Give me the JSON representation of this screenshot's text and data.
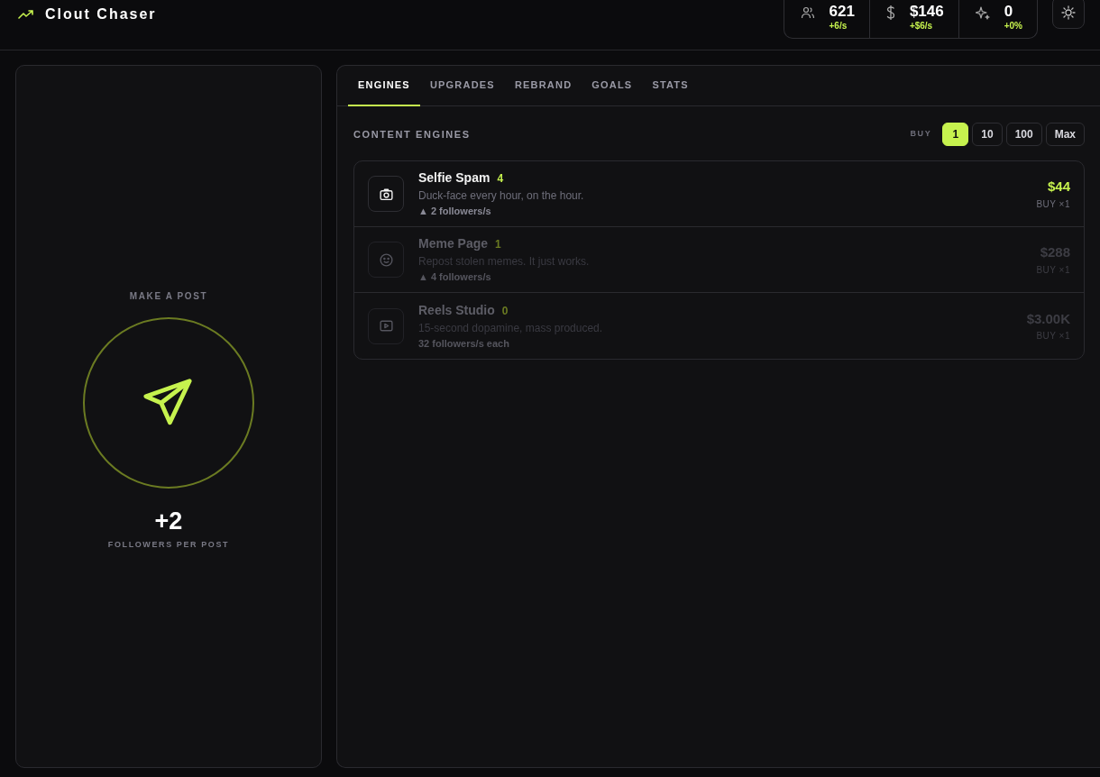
{
  "app": {
    "title": "Clout Chaser"
  },
  "stats": [
    {
      "kind": "followers",
      "value": "621",
      "rate": "+6/s"
    },
    {
      "kind": "cash",
      "value": "$146",
      "rate": "+$6/s"
    },
    {
      "kind": "clout",
      "value": "0",
      "rate": "+0%"
    }
  ],
  "post_panel": {
    "label": "MAKE A POST",
    "gain": "+2",
    "caption": "FOLLOWERS PER POST"
  },
  "tabs": [
    {
      "label": "ENGINES",
      "selected": true
    },
    {
      "label": "UPGRADES",
      "selected": false
    },
    {
      "label": "REBRAND",
      "selected": false
    },
    {
      "label": "GOALS",
      "selected": false
    },
    {
      "label": "STATS",
      "selected": false
    }
  ],
  "section": {
    "title": "CONTENT ENGINES",
    "buy_label": "BUY"
  },
  "buy_options": [
    {
      "label": "1",
      "selected": true
    },
    {
      "label": "10",
      "selected": false
    },
    {
      "label": "100",
      "selected": false
    },
    {
      "label": "Max",
      "selected": false
    }
  ],
  "engines": [
    {
      "kind": "camera",
      "name": "Selfie Spam",
      "owned": "4",
      "description": "Duck-face every hour, on the hour.",
      "rate": "▲ 2 followers/s",
      "price": "$44",
      "buy": "BUY ×1",
      "affordable": true
    },
    {
      "kind": "smile",
      "name": "Meme Page",
      "owned": "1",
      "description": "Repost stolen memes. It just works.",
      "rate": "▲ 4 followers/s",
      "price": "$288",
      "buy": "BUY ×1",
      "affordable": false
    },
    {
      "kind": "video",
      "name": "Reels Studio",
      "owned": "0",
      "description": "15-second dopamine, mass produced.",
      "rate": "32 followers/s each",
      "price": "$3.00K",
      "buy": "BUY ×1",
      "affordable": false
    }
  ]
}
